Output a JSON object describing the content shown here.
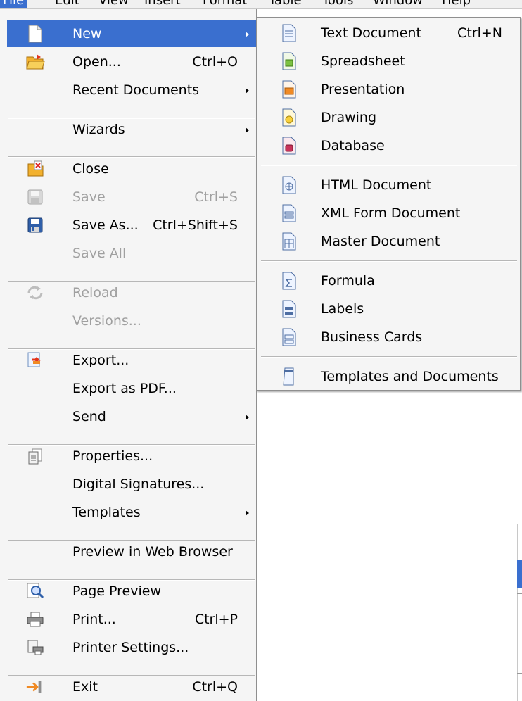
{
  "menubar": {
    "items": [
      "File",
      "Edit",
      "View",
      "Insert",
      "Format",
      "Table",
      "Tools",
      "Window",
      "Help"
    ]
  },
  "file_menu": {
    "new": {
      "label": "New"
    },
    "open": {
      "label": "Open...",
      "shortcut": "Ctrl+O"
    },
    "recent": {
      "label": "Recent Documents"
    },
    "wizards": {
      "label": "Wizards"
    },
    "close": {
      "label": "Close"
    },
    "save": {
      "label": "Save",
      "shortcut": "Ctrl+S"
    },
    "save_as": {
      "label": "Save As...",
      "shortcut": "Ctrl+Shift+S"
    },
    "save_all": {
      "label": "Save All"
    },
    "reload": {
      "label": "Reload"
    },
    "versions": {
      "label": "Versions..."
    },
    "export": {
      "label": "Export..."
    },
    "export_pdf": {
      "label": "Export as PDF..."
    },
    "send": {
      "label": "Send"
    },
    "properties": {
      "label": "Properties..."
    },
    "digital_signatures": {
      "label": "Digital Signatures..."
    },
    "templates": {
      "label": "Templates"
    },
    "preview_web": {
      "label": "Preview in Web Browser"
    },
    "page_preview": {
      "label": "Page Preview"
    },
    "print": {
      "label": "Print...",
      "shortcut": "Ctrl+P"
    },
    "printer_settings": {
      "label": "Printer Settings..."
    },
    "exit": {
      "label": "Exit",
      "shortcut": "Ctrl+Q"
    }
  },
  "new_submenu": {
    "text_document": {
      "label": "Text Document",
      "shortcut": "Ctrl+N"
    },
    "spreadsheet": {
      "label": "Spreadsheet"
    },
    "presentation": {
      "label": "Presentation"
    },
    "drawing": {
      "label": "Drawing"
    },
    "database": {
      "label": "Database"
    },
    "html_document": {
      "label": "HTML Document"
    },
    "xml_form": {
      "label": "XML Form Document"
    },
    "master_document": {
      "label": "Master Document"
    },
    "formula": {
      "label": "Formula"
    },
    "labels": {
      "label": "Labels"
    },
    "business_cards": {
      "label": "Business Cards"
    },
    "templates_docs": {
      "label": "Templates and Documents"
    }
  },
  "colors": {
    "selection": "#3a6fcf",
    "menu_bg": "#f5f5f5",
    "disabled_text": "#a0a0a0"
  }
}
